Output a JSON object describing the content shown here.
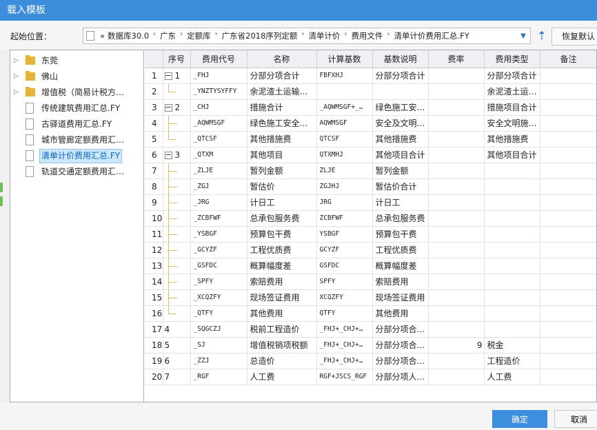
{
  "window": {
    "title": "载入模板"
  },
  "path": {
    "label": "起始位置：",
    "chevrons": "«",
    "segments": [
      "数据库30.0",
      "广东",
      "定额库",
      "广东省2018序列定额",
      "清单计价",
      "费用文件",
      "清单计价费用汇总.FY"
    ],
    "dropdown_icon": "chevron-down-icon"
  },
  "toolbar": {
    "up_icon": "arrow-up-icon",
    "restore_label": "恢复默认"
  },
  "tree": {
    "items": [
      {
        "label": "东莞",
        "type": "folder",
        "expandable": true
      },
      {
        "label": "佛山",
        "type": "folder",
        "expandable": true
      },
      {
        "label": "增值税（简易计税方…",
        "type": "folder",
        "expandable": true
      },
      {
        "label": "传统建筑费用汇总.FY",
        "type": "file"
      },
      {
        "label": "古驿道费用汇总.FY",
        "type": "file"
      },
      {
        "label": "城市管廊定额费用汇…",
        "type": "file"
      },
      {
        "label": "清单计价费用汇总.FY",
        "type": "file",
        "selected": true
      },
      {
        "label": "轨道交通定额费用汇…",
        "type": "file"
      }
    ]
  },
  "grid": {
    "headers": [
      "",
      "序号",
      "费用代号",
      "名称",
      "计算基数",
      "基数说明",
      "费率",
      "费用类型",
      "备注"
    ],
    "rows": [
      {
        "idx": "1",
        "seq": "1",
        "group": true,
        "code": "_FHJ",
        "name": "分部分项合计",
        "base": "FBFXHJ",
        "desc": "分部分项合计",
        "rate": "",
        "type": "分部分项合计",
        "note": ""
      },
      {
        "idx": "2",
        "seq": "",
        "child": "last",
        "code": "_YNZTYSYFFY",
        "name": "余泥渣土运输…",
        "base": "",
        "desc": "",
        "rate": "",
        "type": "余泥渣土运…",
        "note": ""
      },
      {
        "idx": "3",
        "seq": "2",
        "group": true,
        "code": "_CHJ",
        "name": "措施合计",
        "base": "_AQWMSGF+_…",
        "desc": "绿色施工安…",
        "rate": "",
        "type": "措施项目合计",
        "note": ""
      },
      {
        "idx": "4",
        "seq": "",
        "child": "mid",
        "code": "_AQWMSGF",
        "name": "绿色施工安全…",
        "base": "AQWMSGF",
        "desc": "安全及文明…",
        "rate": "",
        "type": "安全文明施…",
        "note": ""
      },
      {
        "idx": "5",
        "seq": "",
        "child": "last",
        "code": "_QTCSF",
        "name": "其他措施费",
        "base": "QTCSF",
        "desc": "其他措施费",
        "rate": "",
        "type": "其他措施费",
        "note": ""
      },
      {
        "idx": "6",
        "seq": "3",
        "group": true,
        "code": "_QTXM",
        "name": "其他项目",
        "base": "QTXMHJ",
        "desc": "其他项目合计",
        "rate": "",
        "type": "其他项目合计",
        "note": ""
      },
      {
        "idx": "7",
        "seq": "",
        "child": "mid",
        "code": "_ZLJE",
        "name": "暂列金额",
        "base": "ZLJE",
        "desc": "暂列金额",
        "rate": "",
        "type": "",
        "note": ""
      },
      {
        "idx": "8",
        "seq": "",
        "child": "mid",
        "code": "_ZGJ",
        "name": "暂估价",
        "base": "ZGJHJ",
        "desc": "暂估价合计",
        "rate": "",
        "type": "",
        "note": ""
      },
      {
        "idx": "9",
        "seq": "",
        "child": "mid",
        "code": "_JRG",
        "name": "计日工",
        "base": "JRG",
        "desc": "计日工",
        "rate": "",
        "type": "",
        "note": ""
      },
      {
        "idx": "10",
        "seq": "",
        "child": "mid",
        "code": "_ZCBFWF",
        "name": "总承包服务费",
        "base": "ZCBFWF",
        "desc": "总承包服务费",
        "rate": "",
        "type": "",
        "note": ""
      },
      {
        "idx": "11",
        "seq": "",
        "child": "mid",
        "code": "_YSBGF",
        "name": "预算包干费",
        "base": "YSBGF",
        "desc": "预算包干费",
        "rate": "",
        "type": "",
        "note": ""
      },
      {
        "idx": "12",
        "seq": "",
        "child": "mid",
        "code": "_GCYZF",
        "name": "工程优质费",
        "base": "GCYZF",
        "desc": "工程优质费",
        "rate": "",
        "type": "",
        "note": ""
      },
      {
        "idx": "13",
        "seq": "",
        "child": "mid",
        "code": "_GSFDC",
        "name": "概算幅度差",
        "base": "GSFDC",
        "desc": "概算幅度差",
        "rate": "",
        "type": "",
        "note": ""
      },
      {
        "idx": "14",
        "seq": "",
        "child": "mid",
        "code": "_SPFY",
        "name": "索赔费用",
        "base": "SPFY",
        "desc": "索赔费用",
        "rate": "",
        "type": "",
        "note": ""
      },
      {
        "idx": "15",
        "seq": "",
        "child": "mid",
        "code": "_XCQZFY",
        "name": "现场签证费用",
        "base": "XCQZFY",
        "desc": "现场签证费用",
        "rate": "",
        "type": "",
        "note": ""
      },
      {
        "idx": "16",
        "seq": "",
        "child": "last",
        "code": "_QTFY",
        "name": "其他费用",
        "base": "QTFY",
        "desc": "其他费用",
        "rate": "",
        "type": "",
        "note": ""
      },
      {
        "idx": "17",
        "seq": "4",
        "code": "_SQGCZJ",
        "name": "税前工程造价",
        "base": "_FHJ+_CHJ+…",
        "desc": "分部分项合…",
        "rate": "",
        "type": "",
        "note": ""
      },
      {
        "idx": "18",
        "seq": "5",
        "code": "_SJ",
        "name": "增值税销项税额",
        "base": "_FHJ+_CHJ+…",
        "desc": "分部分项合…",
        "rate": "9",
        "type": "税金",
        "note": ""
      },
      {
        "idx": "19",
        "seq": "6",
        "code": "_ZZJ",
        "name": "总造价",
        "base": "_FHJ+_CHJ+…",
        "desc": "分部分项合…",
        "rate": "",
        "type": "工程造价",
        "note": ""
      },
      {
        "idx": "20",
        "seq": "7",
        "code": "_RGF",
        "name": "人工费",
        "base": "RGF+JSCS_RGF",
        "desc": "分部分项人…",
        "rate": "",
        "type": "人工费",
        "note": ""
      }
    ]
  },
  "footer": {
    "ok_label": "确定",
    "cancel_label": "取消"
  },
  "colors": {
    "titlebar": "#3c8ddc",
    "ok_button": "#3e8ee0",
    "selection": "#cce8ff"
  }
}
